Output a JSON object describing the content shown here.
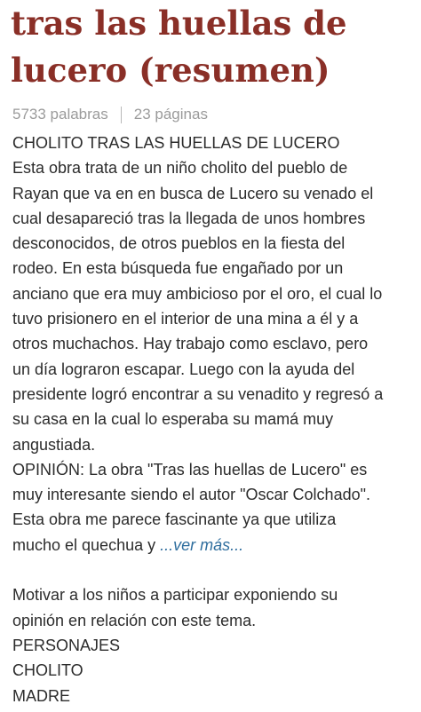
{
  "document": {
    "title": "tras las huellas de lucero (resumen)",
    "words": "5733 palabras",
    "pages": "23 páginas",
    "lines": [
      "CHOLITO TRAS LAS HUELLAS DE LUCERO",
      "Esta obra trata de un niño cholito del pueblo de",
      "Rayan que va en en busca de Lucero su venado el",
      "cual desapareció tras la llegada de unos hombres",
      "desconocidos, de otros pueblos en la fiesta del",
      "rodeo. En esta búsqueda fue engañado por un",
      "anciano que era muy ambicioso por el oro, el cual lo",
      "tuvo prisionero en el interior de una mina a él y a",
      "otros muchachos. Hay trabajo como esclavo, pero",
      "un día lograron escapar. Luego con la ayuda del",
      "presidente logró encontrar a su venadito y regresó a",
      "su casa en la cual lo esperaba su mamá muy",
      "angustiada.",
      "OPINIÓN: La obra \"Tras las huellas de Lucero\" es",
      "muy interesante siendo el autor \"Oscar Colchado\".",
      "Esta obra me parece fascinante ya que utiliza"
    ],
    "last_line_start": "mucho el quechua y ",
    "ver_mas": "...ver más...",
    "after_lines": [
      "Motivar a los niños a participar exponiendo su",
      "opinión en relación con este tema.",
      "PERSONAJES",
      "CHOLITO",
      "MADRE"
    ]
  }
}
